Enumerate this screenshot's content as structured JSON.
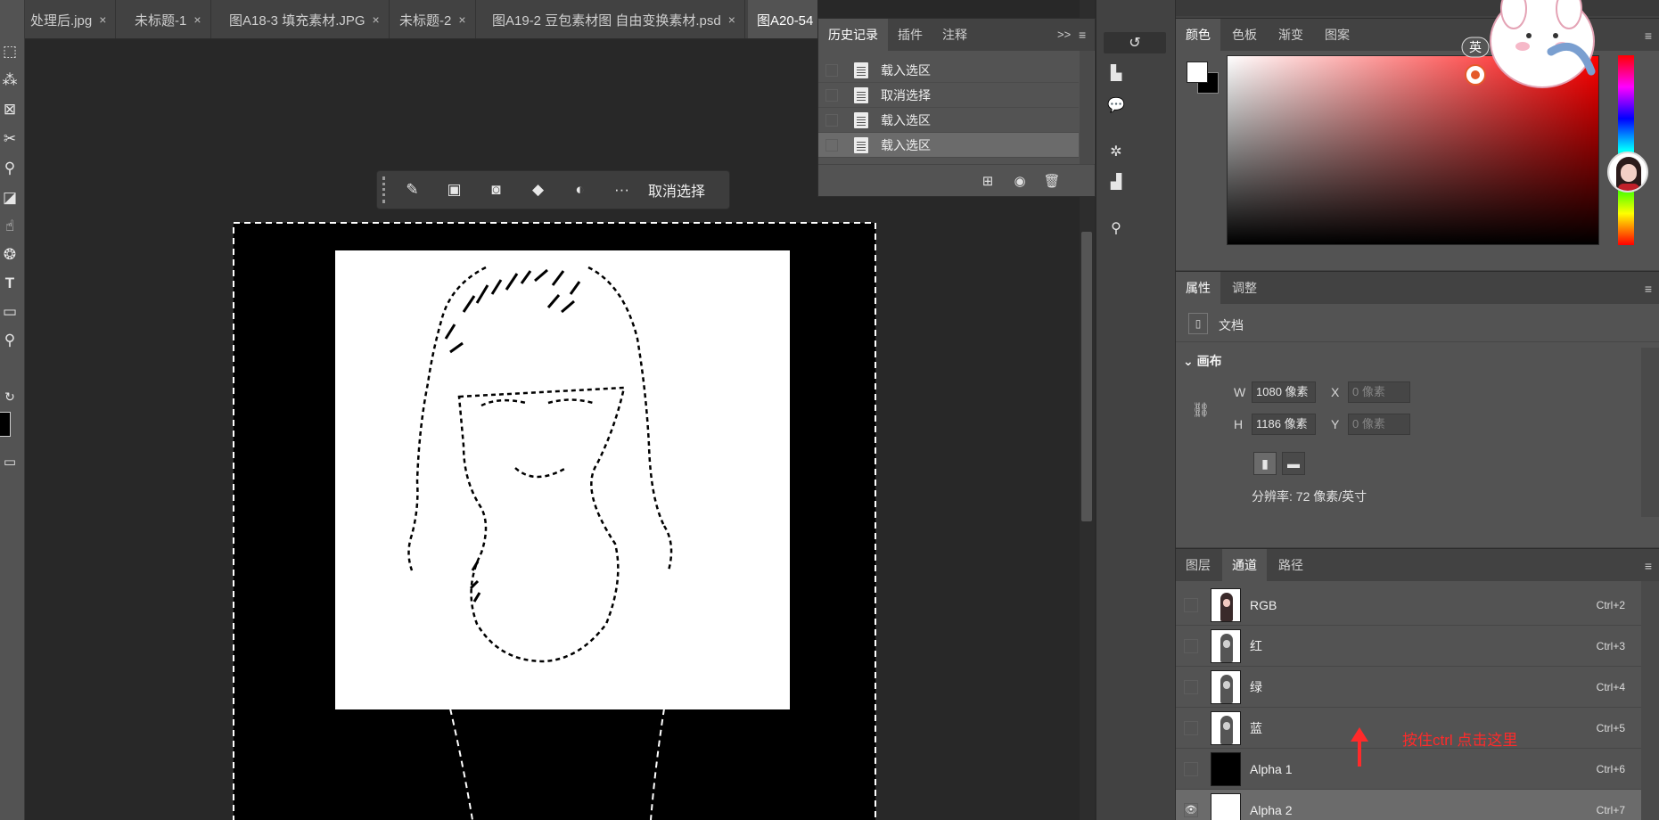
{
  "tabs": [
    {
      "label": "处理后.jpg",
      "close": "×"
    },
    {
      "label": "未标题-1",
      "close": "×"
    },
    {
      "label": "图A18-3 填充素材.JPG",
      "close": "×"
    },
    {
      "label": "未标题-2",
      "close": "×"
    },
    {
      "label": "图A19-2 豆包素材图 自由变换素材.psd",
      "close": "×"
    },
    {
      "label": "图A20-54",
      "close": ""
    }
  ],
  "taskbar": {
    "label": "取消选择",
    "icons": [
      "brush-select-icon",
      "transform-select-icon",
      "mask-icon",
      "fill-bucket-icon",
      "adjust-circle-icon",
      "more-icon"
    ],
    "more_glyph": "···"
  },
  "history": {
    "tabs": [
      "历史记录",
      "插件",
      "注释"
    ],
    "collapse_glyph": ">>",
    "items": [
      "载入选区",
      "取消选择",
      "载入选区",
      "载入选区"
    ],
    "selected_index": 3
  },
  "color_panel": {
    "tabs": [
      "颜色",
      "色板",
      "渐变",
      "图案"
    ],
    "foreground": "#ffffff",
    "background": "#000000"
  },
  "properties": {
    "tabs": [
      "属性",
      "调整"
    ],
    "doc_label": "文档",
    "section": "画布",
    "w_label": "W",
    "w_value": "1080 像素",
    "h_label": "H",
    "h_value": "1186 像素",
    "x_label": "X",
    "x_placeholder": "0 像素",
    "y_label": "Y",
    "y_placeholder": "0 像素",
    "resolution": "分辨率: 72 像素/英寸"
  },
  "channels": {
    "tabs": [
      "图层",
      "通道",
      "路径"
    ],
    "rows": [
      {
        "name": "RGB",
        "shortcut": "Ctrl+2",
        "thumb": "color"
      },
      {
        "name": "红",
        "shortcut": "Ctrl+3",
        "thumb": "gray"
      },
      {
        "name": "绿",
        "shortcut": "Ctrl+4",
        "thumb": "gray"
      },
      {
        "name": "蓝",
        "shortcut": "Ctrl+5",
        "thumb": "gray"
      },
      {
        "name": "Alpha 1",
        "shortcut": "Ctrl+6",
        "thumb": "black"
      },
      {
        "name": "Alpha 2",
        "shortcut": "Ctrl+7",
        "thumb": "white"
      }
    ]
  },
  "annotation": "按住ctrl 点击这里",
  "sticker": {
    "badge": "英"
  },
  "accent_red": "#ff2a2a"
}
